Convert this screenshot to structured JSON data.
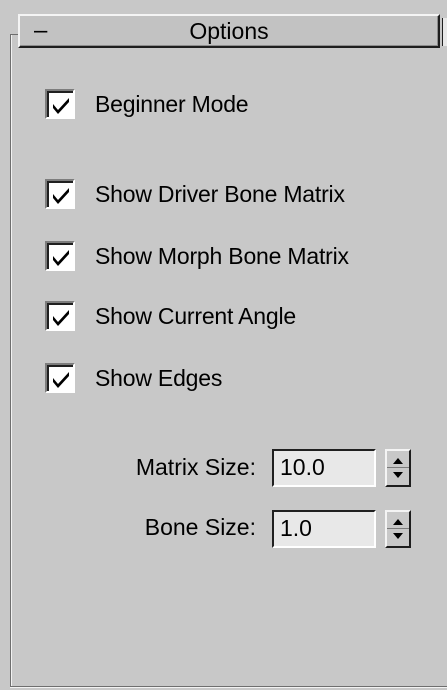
{
  "rollout": {
    "collapse_symbol": "–",
    "title": "Options"
  },
  "options": [
    {
      "label": "Beginner Mode",
      "checked": true
    },
    {
      "label": "Show Driver Bone Matrix",
      "checked": true
    },
    {
      "label": "Show Morph Bone Matrix",
      "checked": true
    },
    {
      "label": "Show Current Angle",
      "checked": true
    },
    {
      "label": "Show Edges",
      "checked": true
    }
  ],
  "fields": [
    {
      "label": "Matrix Size:",
      "value": "10.0"
    },
    {
      "label": "Bone Size:",
      "value": "1.0"
    }
  ]
}
